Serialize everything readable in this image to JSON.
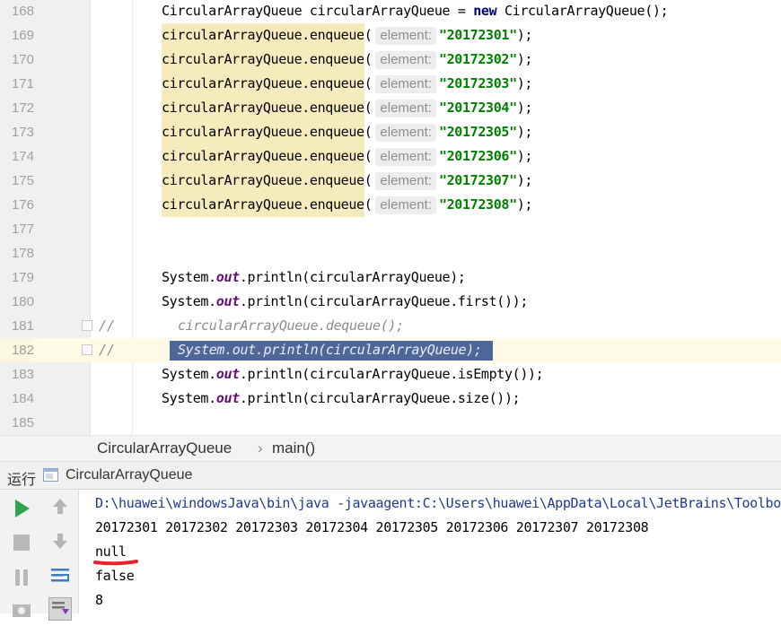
{
  "editor": {
    "lines": [
      {
        "num": "168",
        "kind": "decl",
        "pre": "CircularArrayQueue circularArrayQueue = ",
        "kw": "new",
        "post": " CircularArrayQueue();"
      },
      {
        "num": "169",
        "kind": "enq",
        "call": "circularArrayQueue.enqueue",
        "open": "(",
        "hint": "element:",
        "arg": "\"20172301\"",
        "close": ");"
      },
      {
        "num": "170",
        "kind": "enq",
        "call": "circularArrayQueue.enqueue",
        "open": "(",
        "hint": "element:",
        "arg": "\"20172302\"",
        "close": ");"
      },
      {
        "num": "171",
        "kind": "enq",
        "call": "circularArrayQueue.enqueue",
        "open": "(",
        "hint": "element:",
        "arg": "\"20172303\"",
        "close": ");"
      },
      {
        "num": "172",
        "kind": "enq",
        "call": "circularArrayQueue.enqueue",
        "open": "(",
        "hint": "element:",
        "arg": "\"20172304\"",
        "close": ");"
      },
      {
        "num": "173",
        "kind": "enq",
        "call": "circularArrayQueue.enqueue",
        "open": "(",
        "hint": "element:",
        "arg": "\"20172305\"",
        "close": ");"
      },
      {
        "num": "174",
        "kind": "enq",
        "call": "circularArrayQueue.enqueue",
        "open": "(",
        "hint": "element:",
        "arg": "\"20172306\"",
        "close": ");"
      },
      {
        "num": "175",
        "kind": "enq",
        "call": "circularArrayQueue.enqueue",
        "open": "(",
        "hint": "element:",
        "arg": "\"20172307\"",
        "close": ");"
      },
      {
        "num": "176",
        "kind": "enq",
        "call": "circularArrayQueue.enqueue",
        "open": "(",
        "hint": "element:",
        "arg": "\"20172308\"",
        "close": ");"
      },
      {
        "num": "177",
        "kind": "empty"
      },
      {
        "num": "178",
        "kind": "empty"
      },
      {
        "num": "179",
        "kind": "print",
        "pre": "System.",
        "field": "out",
        "post": ".println(circularArrayQueue);"
      },
      {
        "num": "180",
        "kind": "print",
        "pre": "System.",
        "field": "out",
        "post": ".println(circularArrayQueue.first());"
      },
      {
        "num": "181",
        "kind": "comment",
        "mark": "//",
        "text": "circularArrayQueue.dequeue();"
      },
      {
        "num": "182",
        "kind": "selcomment",
        "mark": "//",
        "text": "System.out.println(circularArrayQueue);"
      },
      {
        "num": "183",
        "kind": "print",
        "pre": "System.",
        "field": "out",
        "post": ".println(circularArrayQueue.isEmpty());"
      },
      {
        "num": "184",
        "kind": "print",
        "pre": "System.",
        "field": "out",
        "post": ".println(circularArrayQueue.size());"
      },
      {
        "num": "185",
        "kind": "empty"
      }
    ]
  },
  "breadcrumb": {
    "class_name": "CircularArrayQueue",
    "separator": "›",
    "method": "main()"
  },
  "run_panel": {
    "title_label": "运行",
    "config_name": "CircularArrayQueue",
    "config_icon": "window-icon"
  },
  "toolbar_icons": [
    "run-icon",
    "up-arrow-icon",
    "stop-icon",
    "down-arrow-icon",
    "pause-icon",
    "soft-wrap-icon",
    "camera-icon",
    "scroll-to-end-icon"
  ],
  "console": {
    "lines": [
      "D:\\huawei\\windowsJava\\bin\\java -javaagent:C:\\Users\\huawei\\AppData\\Local\\JetBrains\\Toolbox",
      "20172301 20172302 20172303 20172304 20172305 20172306 20172307 20172308",
      "null",
      "false",
      "8"
    ],
    "annotation_color": "#e8242a"
  },
  "colors": {
    "keyword": "#000080",
    "string": "#008000",
    "static_field": "#660e7a",
    "enqueue_highlight": "#f6ebbc",
    "selection": "#4f6699",
    "current_line": "#fdfbe6",
    "run_green": "#2da44e"
  }
}
